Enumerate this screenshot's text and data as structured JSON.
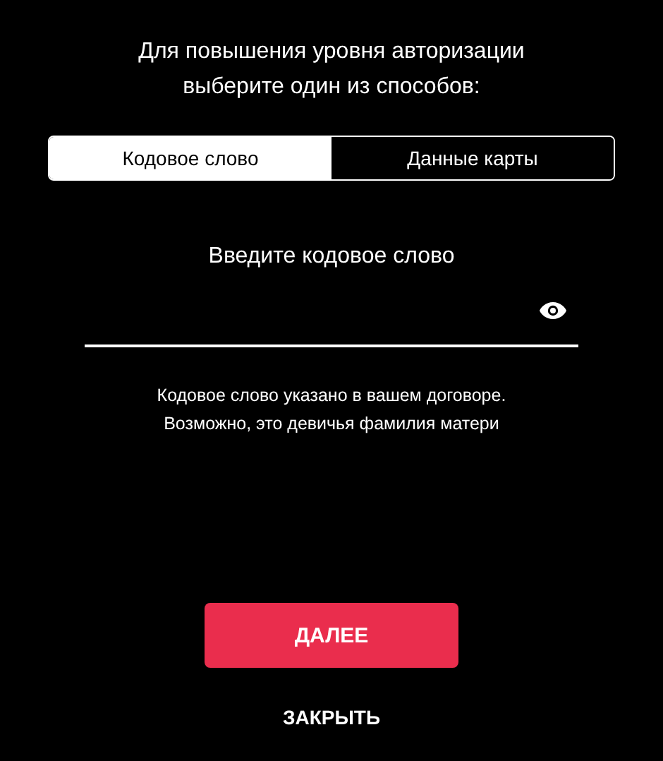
{
  "title": [
    "Для повышения уровня авторизации",
    "выберите один из способов:"
  ],
  "tabs": [
    {
      "label": "Кодовое слово",
      "selected": true
    },
    {
      "label": "Данные карты",
      "selected": false
    }
  ],
  "field": {
    "placeholder": "Введите кодовое слово"
  },
  "hint": [
    "Кодовое слово указано в вашем договоре.",
    "Возможно, это девичья фамилия матери"
  ],
  "primary_button": "ДАЛЕЕ",
  "close_button": "ЗАКРЫТЬ"
}
